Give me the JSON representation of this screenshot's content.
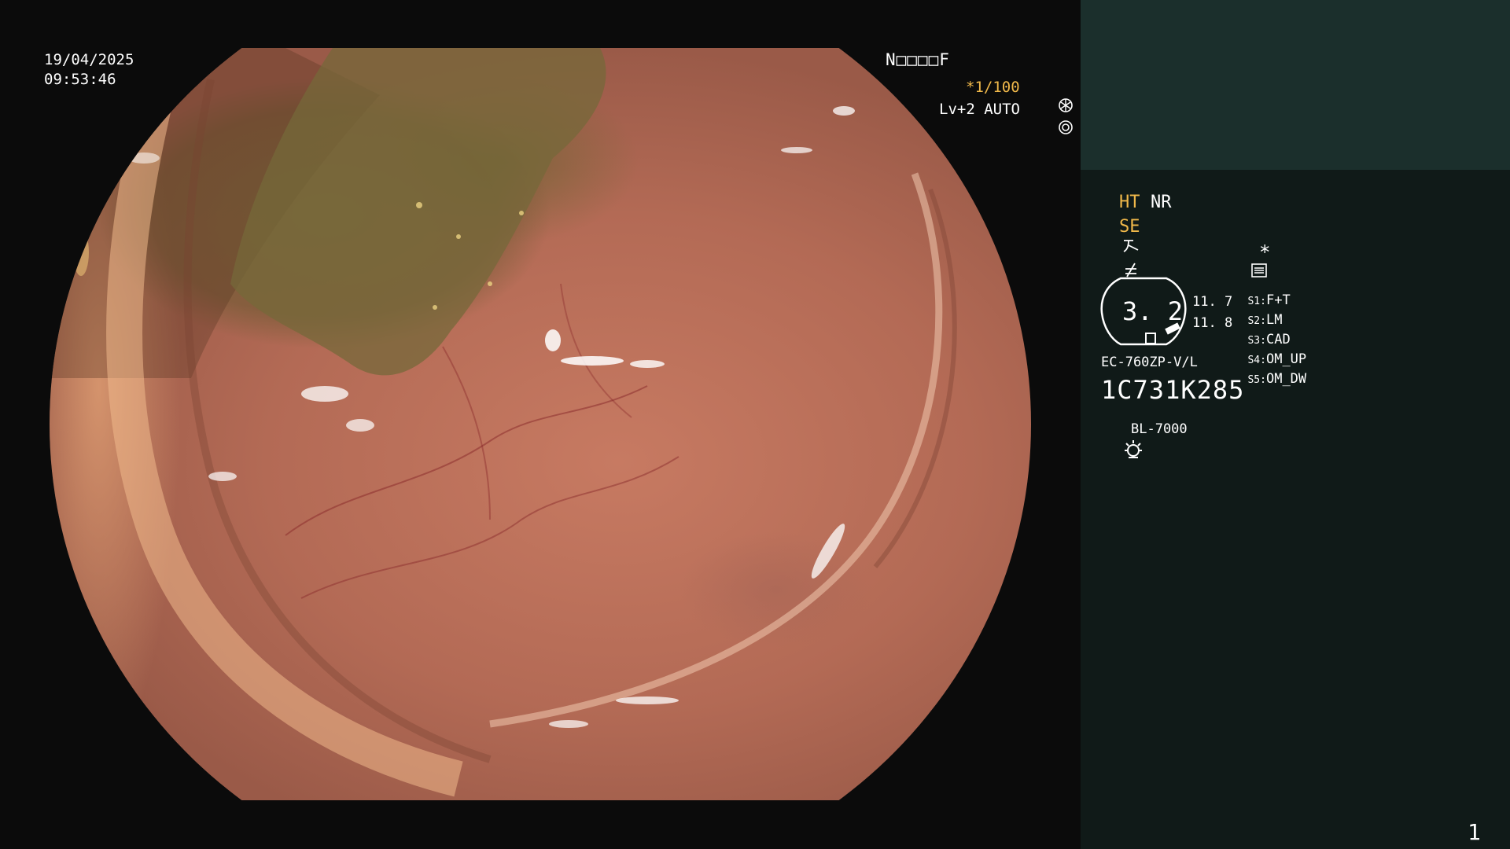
{
  "overlay": {
    "date": "19/04/2025",
    "time": "09:53:46",
    "patient_id": "N□□□□F",
    "shutter": "*1/100",
    "shutter_icon": "shutter-icon",
    "level": "Lv+2 AUTO",
    "auto_icon": "iris-icon"
  },
  "panel": {
    "ht_label": "HT",
    "nr_label": "NR",
    "se_label": "SE",
    "structure_icon": "structure-enhance-icon",
    "contrast_icon": "contrast-icon",
    "memo_icon": "memo-icon",
    "asterisk": "*",
    "magnification": "3. 2",
    "val_top": "11. 7",
    "val_bottom": "11. 8",
    "scope_model": "EC-760ZP-V/L",
    "serial": "1C731K285",
    "light_icon": "light-source-icon",
    "light_source": "BL-7000",
    "switches": [
      {
        "key": "S1",
        "value": "F+T"
      },
      {
        "key": "S2",
        "value": "LM"
      },
      {
        "key": "S3",
        "value": "CAD"
      },
      {
        "key": "S4",
        "value": "OM_UP"
      },
      {
        "key": "S5",
        "value": "OM_DW"
      }
    ],
    "page_number": "1"
  },
  "colors": {
    "accent_yellow": "#f0b84a",
    "panel_bg": "#101a18",
    "panel_top_bg": "#1b2f2c",
    "video_bg": "#0b0b0b"
  }
}
